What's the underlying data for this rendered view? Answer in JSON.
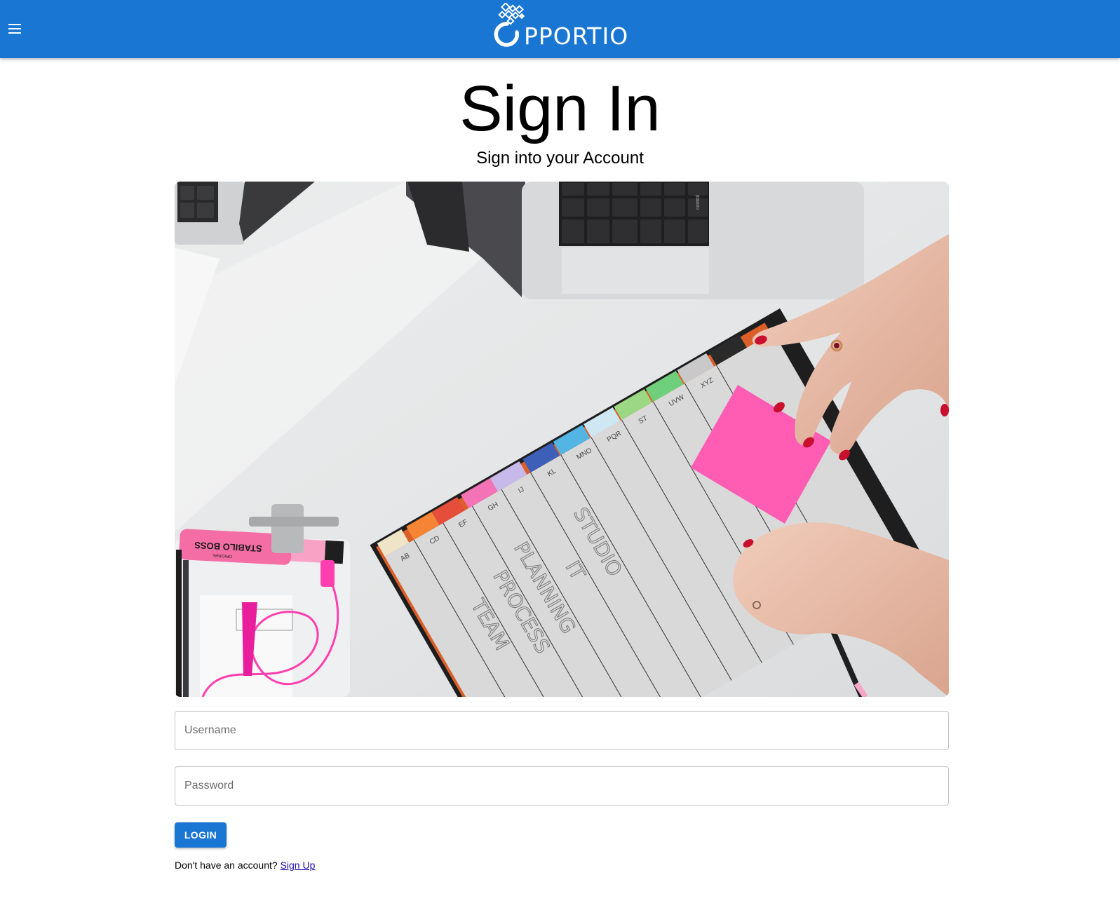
{
  "header": {
    "logo_text": "PPORTIO",
    "menu_icon": "hamburger-menu-icon",
    "background_color": "#1976d2"
  },
  "main": {
    "title": "Sign In",
    "subtitle": "Sign into your Account",
    "hero_image": {
      "description_icon": "workspace-photo",
      "handwriting": [
        "TEAM",
        "PROCESS",
        "PLANNING",
        "IT",
        "STUDIO"
      ],
      "tab_letters": [
        "AB",
        "CD",
        "EF",
        "GH",
        "IJ",
        "KL",
        "MNO",
        "PQR",
        "ST",
        "UVW",
        "XYZ"
      ],
      "highlighter_label": "STABILO BOSS",
      "highlighter_sub": "ORIGINAL",
      "key_label": "control"
    }
  },
  "form": {
    "username_placeholder": "Username",
    "password_placeholder": "Password",
    "login_label": "LOGIN",
    "signup_prompt": "Don't have an account?",
    "signup_link": "Sign Up"
  }
}
